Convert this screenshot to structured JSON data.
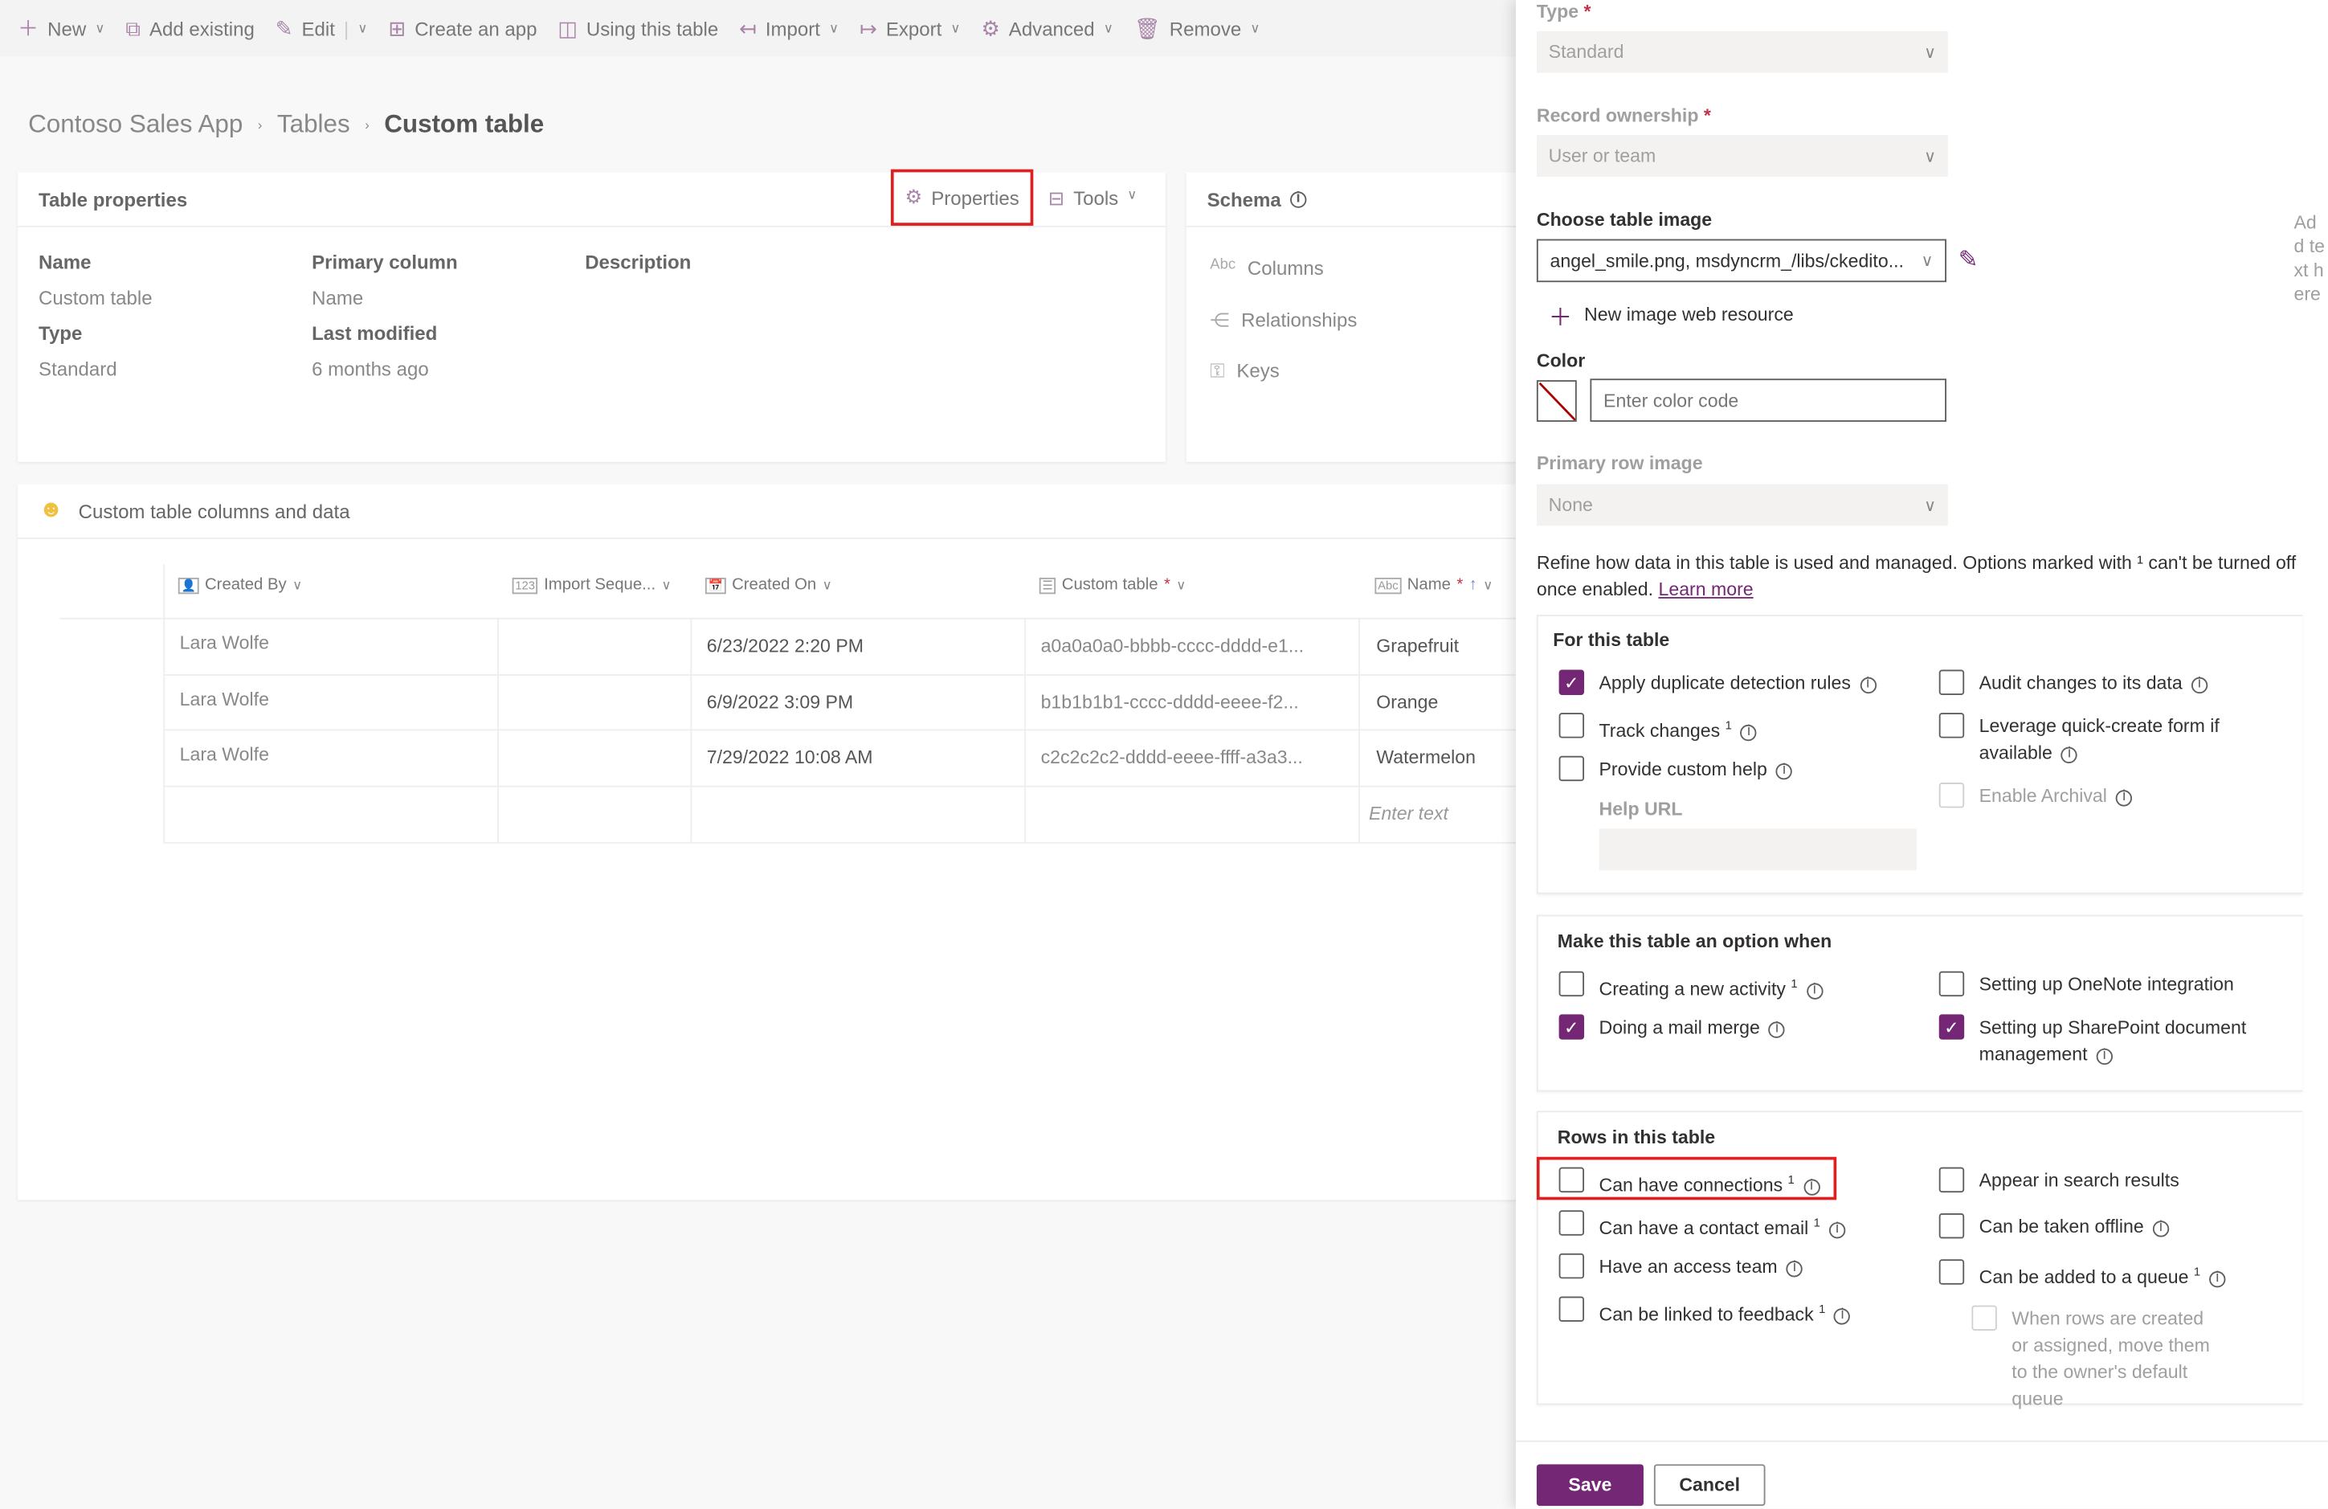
{
  "toolbar": {
    "items": [
      "New",
      "Add existing",
      "Edit",
      "Create an app",
      "Using this table",
      "Import",
      "Export",
      "Advanced",
      "Remove"
    ]
  },
  "breadcrumb": [
    "Contoso Sales App",
    "Tables",
    "Custom table"
  ],
  "table_properties": {
    "title": "Table properties",
    "properties_button": "Properties",
    "tools_button": "Tools",
    "fields": {
      "name_label": "Name",
      "name_value": "Custom table",
      "primary_label": "Primary column",
      "primary_value": "Name",
      "desc_label": "Description",
      "type_label": "Type",
      "type_value": "Standard",
      "modified_label": "Last modified",
      "modified_value": "6 months ago"
    }
  },
  "schema": {
    "title": "Schema",
    "items": [
      "Columns",
      "Relationships",
      "Keys"
    ]
  },
  "data_card": {
    "title": "Custom table columns and data",
    "columns": [
      "Created By",
      "Import Seque...",
      "Created On",
      "Custom table",
      "Name"
    ],
    "rows": [
      [
        "Lara Wolfe",
        "",
        "6/23/2022 2:20 PM",
        "a0a0a0a0-bbbb-cccc-dddd-e1...",
        "Grapefruit"
      ],
      [
        "Lara Wolfe",
        "",
        "6/9/2022 3:09 PM",
        "b1b1b1b1-cccc-dddd-eeee-f2...",
        "Orange"
      ],
      [
        "Lara Wolfe",
        "",
        "7/29/2022 10:08 AM",
        "c2c2c2c2-dddd-eeee-ffff-a3a3...",
        "Watermelon"
      ]
    ],
    "new_row_placeholder": "Enter text"
  },
  "panel": {
    "type_label": "Type",
    "type_value": "Standard",
    "ownership_label": "Record ownership",
    "ownership_value": "User or team",
    "image_label": "Choose table image",
    "image_value": "angel_smile.png, msdyncrm_/libs/ckedito...",
    "new_image": "New image web resource",
    "color_label": "Color",
    "color_placeholder": "Enter color code",
    "row_image_label": "Primary row image",
    "row_image_value": "None",
    "refine_text": "Refine how data in this table is used and managed. Options marked with ¹ can't be turned off once enabled.",
    "learn_more": "Learn more",
    "side_hint": "Add text here",
    "for_table": {
      "title": "For this table",
      "options": [
        {
          "label": "Apply duplicate detection rules",
          "checked": true
        },
        {
          "label": "Audit changes to its data",
          "checked": false
        },
        {
          "label": "Track changes ¹",
          "checked": false
        },
        {
          "label": "Leverage quick-create form if available",
          "checked": false
        },
        {
          "label": "Provide custom help",
          "checked": false
        },
        {
          "label": "Enable Archival",
          "checked": false,
          "disabled": true
        }
      ],
      "help_url_label": "Help URL"
    },
    "option_when": {
      "title": "Make this table an option when",
      "options": [
        {
          "label": "Creating a new activity ¹",
          "checked": false
        },
        {
          "label": "Setting up OneNote integration",
          "checked": false
        },
        {
          "label": "Doing a mail merge",
          "checked": true
        },
        {
          "label": "Setting up SharePoint document management",
          "checked": true
        }
      ]
    },
    "rows": {
      "title": "Rows in this table",
      "options": [
        {
          "label": "Can have connections ¹",
          "checked": false
        },
        {
          "label": "Appear in search results",
          "checked": false
        },
        {
          "label": "Can have a contact email ¹",
          "checked": false
        },
        {
          "label": "Can be taken offline",
          "checked": false
        },
        {
          "label": "Have an access team",
          "checked": false
        },
        {
          "label": "Can be added to a queue ¹",
          "checked": false
        },
        {
          "label": "Can be linked to feedback ¹",
          "checked": false
        },
        {
          "label": "When rows are created or assigned, move them to the owner's default queue",
          "checked": false,
          "disabled": true
        }
      ]
    },
    "save": "Save",
    "cancel": "Cancel",
    "accent": "#742774"
  }
}
